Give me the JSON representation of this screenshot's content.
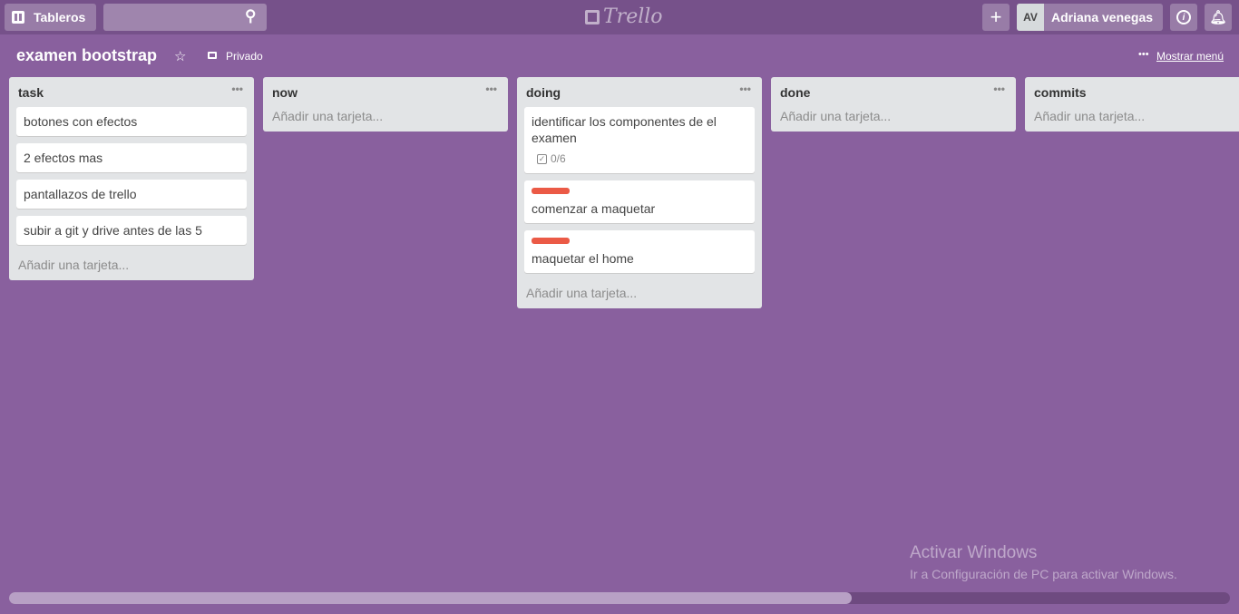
{
  "header": {
    "boards_label": "Tableros",
    "search_placeholder": "",
    "logo": "Trello",
    "avatar_initials": "AV",
    "user_name": "Adriana venegas"
  },
  "board": {
    "title": "examen bootstrap",
    "visibility": "Privado",
    "show_menu": "Mostrar menú"
  },
  "add_card": "Añadir una tarjeta...",
  "lists": [
    {
      "name": "task",
      "cards": [
        {
          "title": "botones con efectos"
        },
        {
          "title": "2 efectos mas"
        },
        {
          "title": "pantallazos de trello"
        },
        {
          "title": "subir a git y drive antes de las 5"
        }
      ]
    },
    {
      "name": "now",
      "cards": []
    },
    {
      "name": "doing",
      "cards": [
        {
          "title": "identificar los componentes de el examen",
          "checklist": "0/6"
        },
        {
          "title": "comenzar a maquetar",
          "label_color": "#eb5a46"
        },
        {
          "title": "maquetar el home",
          "label_color": "#eb5a46"
        }
      ]
    },
    {
      "name": "done",
      "cards": []
    },
    {
      "name": "commits",
      "cards": []
    }
  ],
  "watermark": {
    "title": "Activar Windows",
    "subtitle": "Ir a Configuración de PC para activar Windows."
  },
  "scroll": {
    "position_fraction": 0.69
  }
}
